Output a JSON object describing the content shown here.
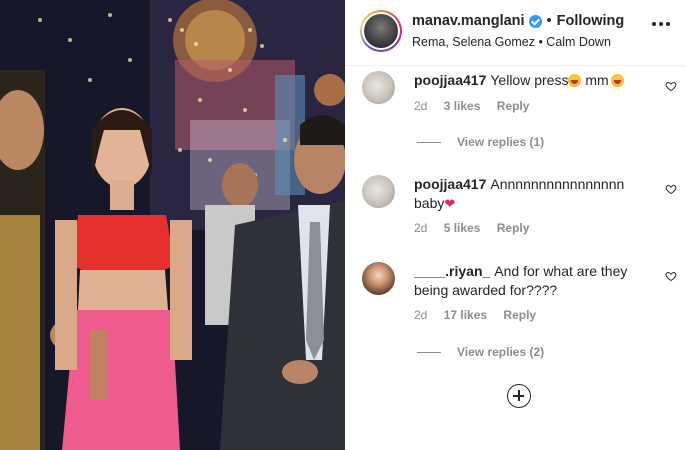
{
  "post": {
    "username": "manav.manglani",
    "separator": "•",
    "follow_state": "Following",
    "audio": "Rema, Selena Gomez • Calm Down",
    "more_icon": "more-horizontal-icon"
  },
  "comments": [
    {
      "username": "poojjaa417",
      "text": "Yellow press",
      "text_after_emoji": " mm",
      "avatar": "dog-avatar",
      "time": "2d",
      "likes": "3 likes",
      "reply": "Reply",
      "view_replies": "View replies (1)"
    },
    {
      "username": "poojjaa417",
      "text": "Annnnnnnnnnnnnnnn baby",
      "avatar": "dog-avatar",
      "time": "2d",
      "likes": "5 likes",
      "reply": "Reply"
    },
    {
      "username": "____.riyan_",
      "text": "And for what are they being awarded for????",
      "avatar": "girl-avatar",
      "time": "2d",
      "likes": "17 likes",
      "reply": "Reply",
      "view_replies": "View replies (2)"
    }
  ],
  "icons": {
    "heart": "heart-outline-icon",
    "load_more": "plus-circle-icon",
    "verified": "verified-badge-icon"
  },
  "colors": {
    "verified_blue": "#3897f0",
    "meta_gray": "#8e8e8e",
    "text": "#262626"
  }
}
